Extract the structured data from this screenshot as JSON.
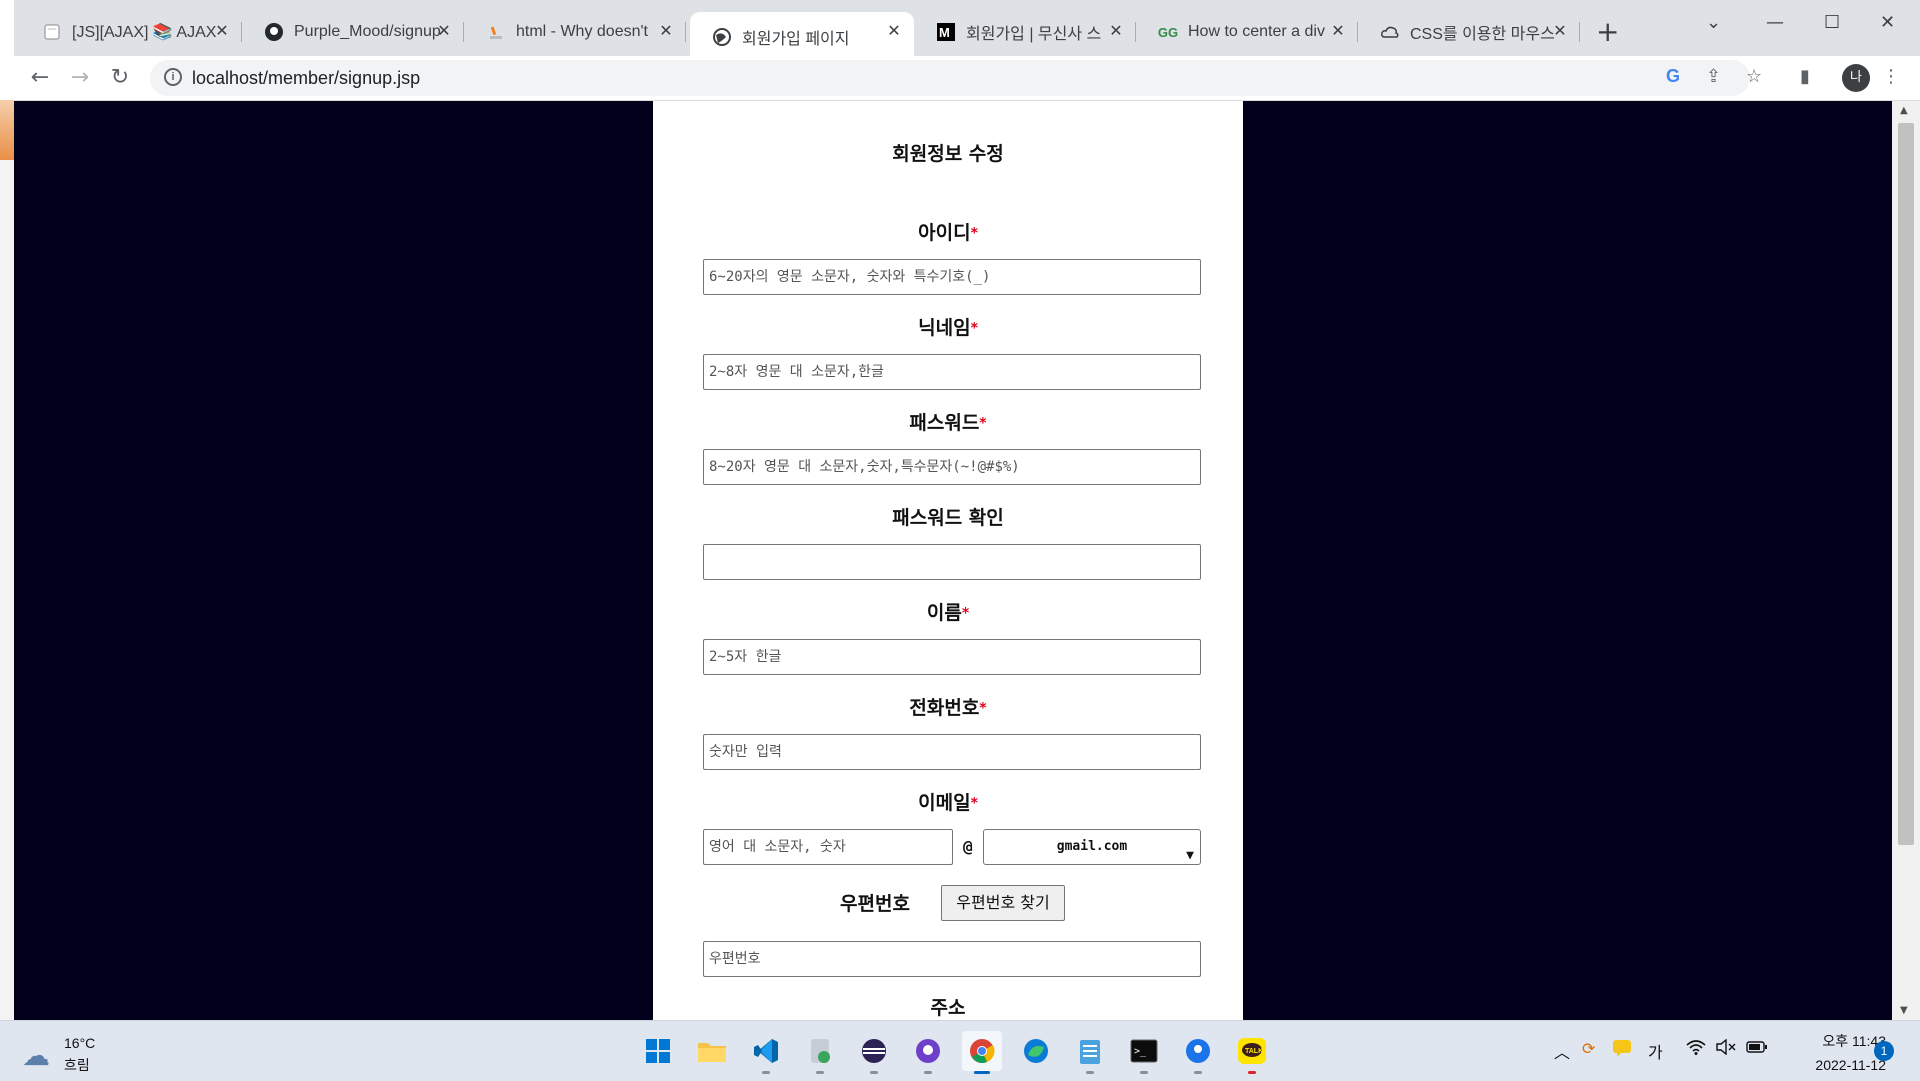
{
  "browser": {
    "tabs": [
      {
        "title": "[JS][AJAX] 📚 AJAX",
        "favicon": "notebook-icon"
      },
      {
        "title": "Purple_Mood/signup",
        "favicon": "github-icon"
      },
      {
        "title": "html - Why doesn't",
        "favicon": "stackoverflow-icon"
      },
      {
        "title": "회원가입 페이지",
        "favicon": "globe-icon"
      },
      {
        "title": "회원가입 | 무신사 스",
        "favicon": "musinsa-icon"
      },
      {
        "title": "How to center a div",
        "favicon": "gfg-icon"
      },
      {
        "title": "CSS를 이용한 마우스",
        "favicon": "cloud-icon"
      }
    ],
    "active_tab_index": 3,
    "url": "localhost/member/signup.jsp",
    "profile_initial": "나"
  },
  "form": {
    "title": "회원정보 수정",
    "required_mark": "*",
    "fields": [
      {
        "label": "아이디",
        "required": true,
        "placeholder": "6~20자의 영문 소문자, 숫자와 특수기호(_)"
      },
      {
        "label": "닉네임",
        "required": true,
        "placeholder": "2~8자 영문 대 소문자,한글"
      },
      {
        "label": "패스워드",
        "required": true,
        "placeholder": "8~20자 영문 대 소문자,숫자,특수문자(~!@#$%)"
      },
      {
        "label": "패스워드 확인",
        "required": false,
        "placeholder": ""
      },
      {
        "label": "이름",
        "required": true,
        "placeholder": "2~5자 한글"
      },
      {
        "label": "전화번호",
        "required": true,
        "placeholder": "숫자만 입력"
      }
    ],
    "email": {
      "label": "이메일",
      "required": true,
      "local_placeholder": "영어 대 소문자, 숫자",
      "at": "@",
      "domain_selected": "gmail.com"
    },
    "zipcode": {
      "label": "우편번호",
      "button": "우편번호 찾기",
      "placeholder": "우편번호"
    },
    "address": {
      "label": "주소"
    }
  },
  "taskbar": {
    "weather_temp": "16°C",
    "weather_condition": "흐림",
    "ime": "가",
    "clock_ampm_time": "오후 11:43",
    "clock_date": "2022-11-12",
    "notification_count": "1"
  }
}
